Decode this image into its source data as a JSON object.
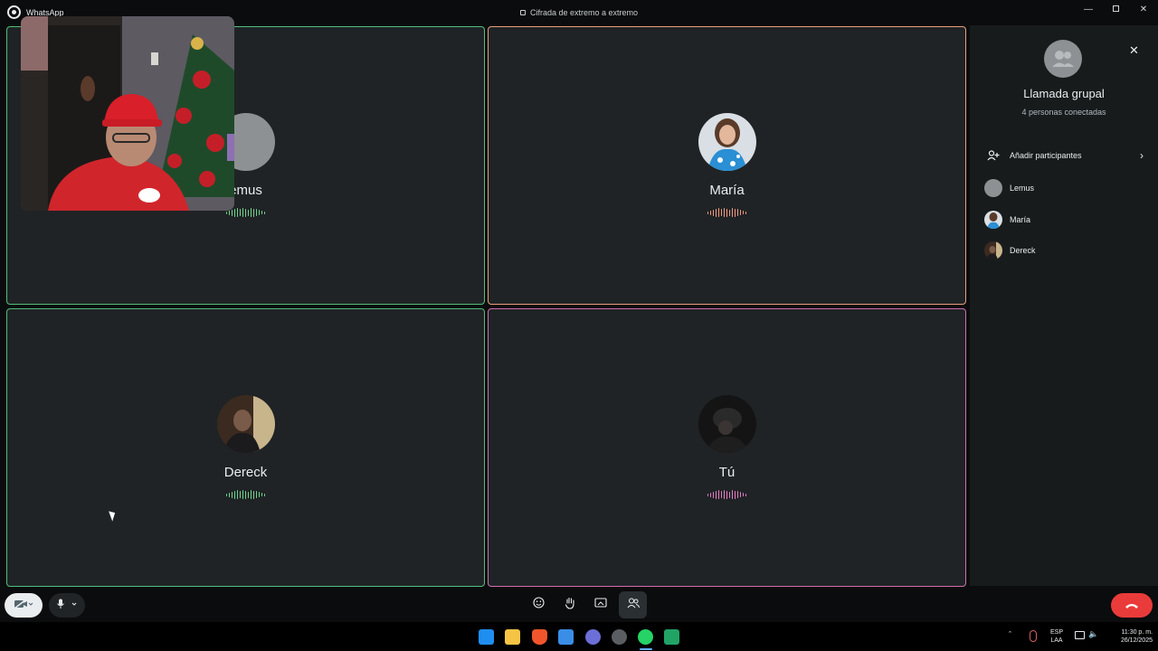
{
  "window": {
    "app_name": "WhatsApp",
    "encryption_notice": "Cifrada de extremo a extremo",
    "minimize_icon": "minimize-icon",
    "restore_icon": "restore-icon",
    "close_icon": "close-icon"
  },
  "participants_grid": [
    {
      "name": "Lemus",
      "visible_name": "emus",
      "border_color": "#53bd7b",
      "wave_color": "#6fd48f",
      "avatar": "default-avatar"
    },
    {
      "name": "María",
      "visible_name": "María",
      "border_color": "#e8a17a",
      "wave_color": "#f09b82",
      "avatar": "photo-avatar"
    },
    {
      "name": "Dereck",
      "visible_name": "Dereck",
      "border_color": "#53bd7b",
      "wave_color": "#6fd48f",
      "avatar": "photo-avatar"
    },
    {
      "name": "Tú",
      "visible_name": "Tú",
      "border_color": "#d06fb0",
      "wave_color": "#e27cc6",
      "avatar": "photo-avatar"
    }
  ],
  "panel": {
    "title": "Llamada grupal",
    "subtitle": "4 personas conectadas",
    "add_participants": "Añadir participantes",
    "people": [
      {
        "name": "Lemus"
      },
      {
        "name": "María"
      },
      {
        "name": "Dereck"
      }
    ]
  },
  "controls": {
    "video_toggle_icon": "camera-off-icon",
    "mic_icon": "microphone-icon",
    "emoji_icon": "emoji-icon",
    "raise_hand_icon": "raise-hand-icon",
    "share_screen_icon": "share-screen-icon",
    "participants_icon": "participants-icon",
    "end_call_icon": "end-call-icon",
    "end_call_color": "#ea3b3b"
  },
  "taskbar": {
    "language": "ESP",
    "layout": "LAA",
    "time": "11:30 p. m.",
    "date": "26/12/2025"
  }
}
